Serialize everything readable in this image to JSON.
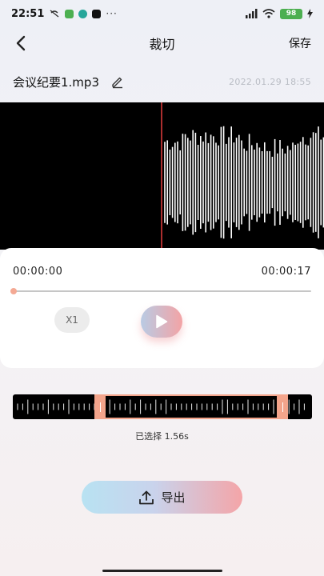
{
  "status_bar": {
    "time": "22:51",
    "more": "···",
    "battery": "98"
  },
  "nav": {
    "title": "裁切",
    "save_label": "保存"
  },
  "file": {
    "name": "会议纪要1.mp3",
    "date": "2022.01.29  18:55"
  },
  "player": {
    "time_start": "00:00:00",
    "time_end": "00:00:17",
    "progress_fraction": 0,
    "speed_label": "X1"
  },
  "selection": {
    "label": "已选择 1.56s"
  },
  "export": {
    "label": "导出"
  },
  "colors": {
    "accent": "#f3a48b",
    "playhead": "#d63a3a",
    "wave": "#ffffff"
  }
}
